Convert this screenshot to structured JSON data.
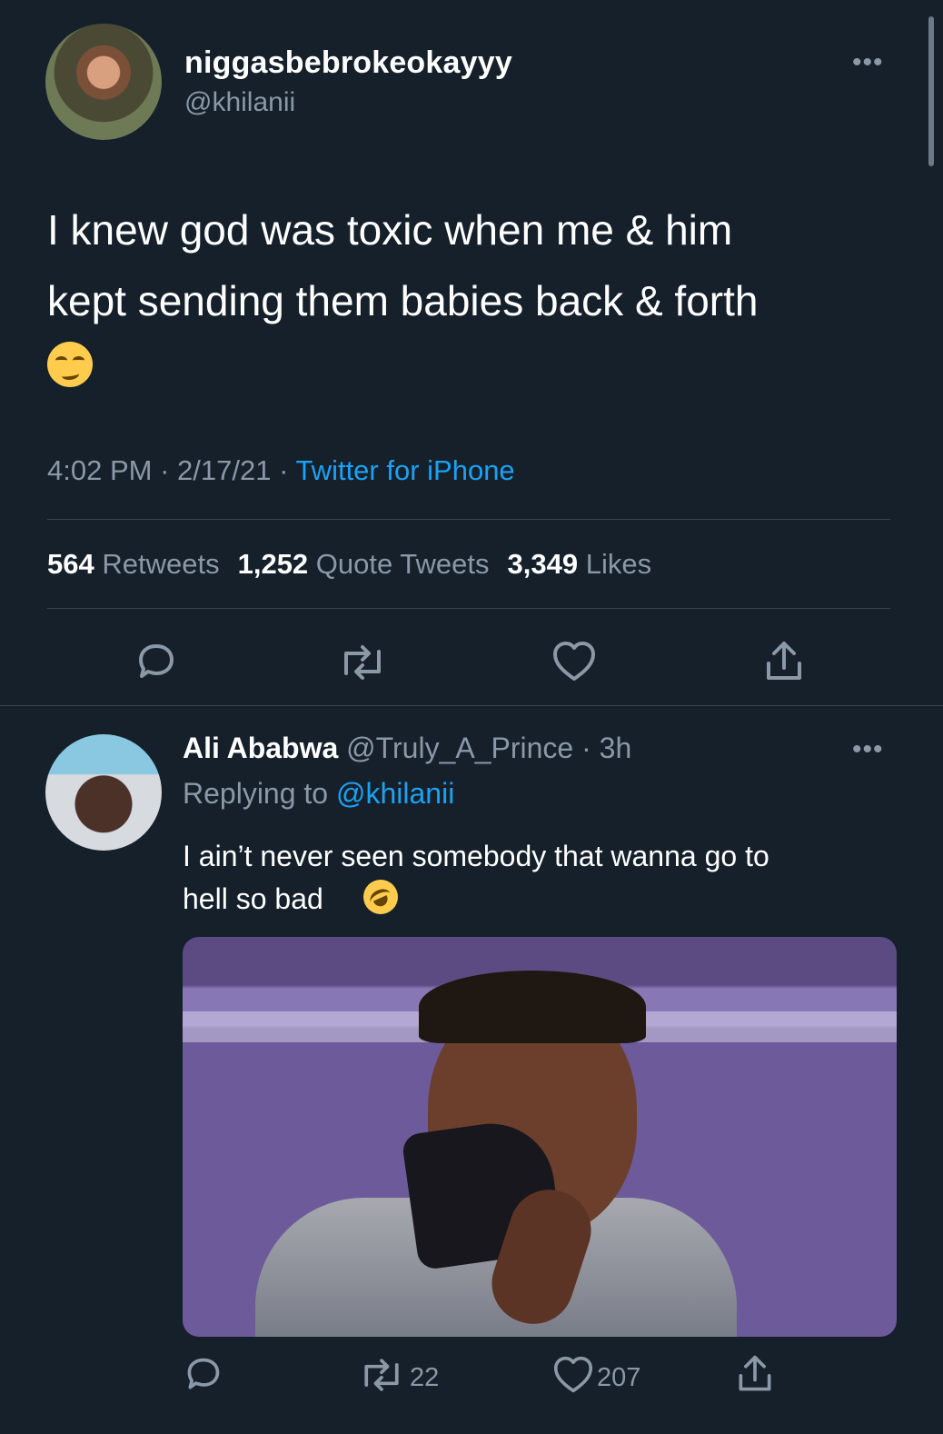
{
  "main_tweet": {
    "display_name": "niggasbebrokeokayyy",
    "handle": "@khilanii",
    "text": "I knew god was toxic when me & him\nkept sending them babies back & forth",
    "time": "4:02 PM",
    "date": "2/17/21",
    "source": "Twitter for iPhone",
    "meta_separator": " · ",
    "stats": {
      "retweets": "564",
      "retweets_label": "Retweets",
      "quote_tweets": "1,252",
      "quote_tweets_label": "Quote Tweets",
      "likes": "3,349",
      "likes_label": "Likes"
    },
    "icons": {
      "avatar": "avatar-image",
      "reply": "reply-icon",
      "retweet": "retweet-icon",
      "like": "heart-icon",
      "share": "share-icon",
      "more": "more-icon",
      "emoji": "woozy-face-emoji"
    }
  },
  "reply_tweet": {
    "display_name": "Ali Ababwa",
    "handle": "@Truly_A_Prince",
    "time": "· 3h",
    "replying_to_label": "Replying to",
    "replying_to_handle": "@khilanii",
    "text": "I ain’t never seen somebody that wanna go to\nhell so bad",
    "retweet_count": "22",
    "like_count": "207",
    "icons": {
      "avatar": "avatar-image",
      "reply": "reply-icon",
      "retweet": "retweet-icon",
      "like": "heart-icon",
      "share": "share-icon",
      "more": "more-icon",
      "emoji": "rolling-on-the-floor-laughing-emoji",
      "media": "media-image"
    }
  },
  "theme": {
    "background": "#15202b",
    "text": "#ffffff",
    "secondary_text": "#8b98a5",
    "link": "#1da1f2",
    "divider": "#38444d"
  }
}
